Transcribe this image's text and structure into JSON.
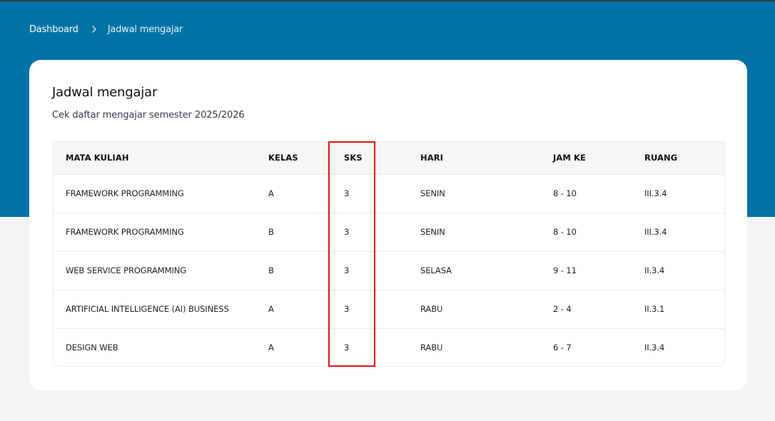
{
  "breadcrumb": {
    "home": "Dashboard",
    "current": "Jadwal mengajar"
  },
  "card": {
    "title": "Jadwal mengajar",
    "subtitle": "Cek daftar mengajar semester 2025/2026"
  },
  "table": {
    "headers": [
      "MATA KULIAH",
      "KELAS",
      "SKS",
      "HARI",
      "JAM KE",
      "RUANG"
    ],
    "rows": [
      [
        "FRAMEWORK PROGRAMMING",
        "A",
        "3",
        "SENIN",
        "8 - 10",
        "III.3.4"
      ],
      [
        "FRAMEWORK PROGRAMMING",
        "B",
        "3",
        "SENIN",
        "8 - 10",
        "III.3.4"
      ],
      [
        "WEB SERVICE PROGRAMMING",
        "B",
        "3",
        "SELASA",
        "9 - 11",
        "II.3.4"
      ],
      [
        "ARTIFICIAL INTELLIGENCE (AI) BUSINESS",
        "A",
        "3",
        "RABU",
        "2 - 4",
        "II.3.1"
      ],
      [
        "DESIGN WEB",
        "A",
        "3",
        "RABU",
        "6 - 7",
        "II.3.4"
      ]
    ]
  },
  "colors": {
    "banner": "#0072a8",
    "page_background": "#f4f4f4",
    "highlight": "#e01414"
  },
  "icons": {
    "breadcrumb_separator": "chevron-right-icon"
  }
}
